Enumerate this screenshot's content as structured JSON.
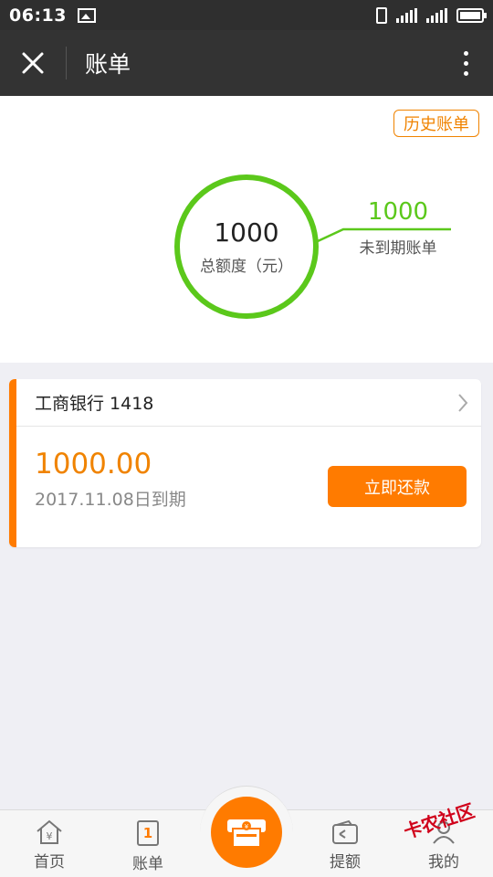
{
  "status_bar": {
    "time": "06:13",
    "network": "4G"
  },
  "header": {
    "title": "账单"
  },
  "summary": {
    "history_label": "历史账单",
    "total_amount": "1000",
    "total_label": "总额度（元）",
    "unpaid_amount": "1000",
    "unpaid_label": "未到期账单"
  },
  "bill": {
    "bank": "工商银行 1418",
    "amount": "1000.00",
    "due": "2017.11.08日到期",
    "repay_label": "立即还款"
  },
  "nav": {
    "items": [
      {
        "label": "首页"
      },
      {
        "label": "账单",
        "badge": "1"
      },
      {
        "label": "提额"
      },
      {
        "label": "我的"
      }
    ]
  },
  "watermark": "卡农社区",
  "colors": {
    "accent": "#ff7b00",
    "green": "#5bc81b",
    "header": "#333333"
  }
}
